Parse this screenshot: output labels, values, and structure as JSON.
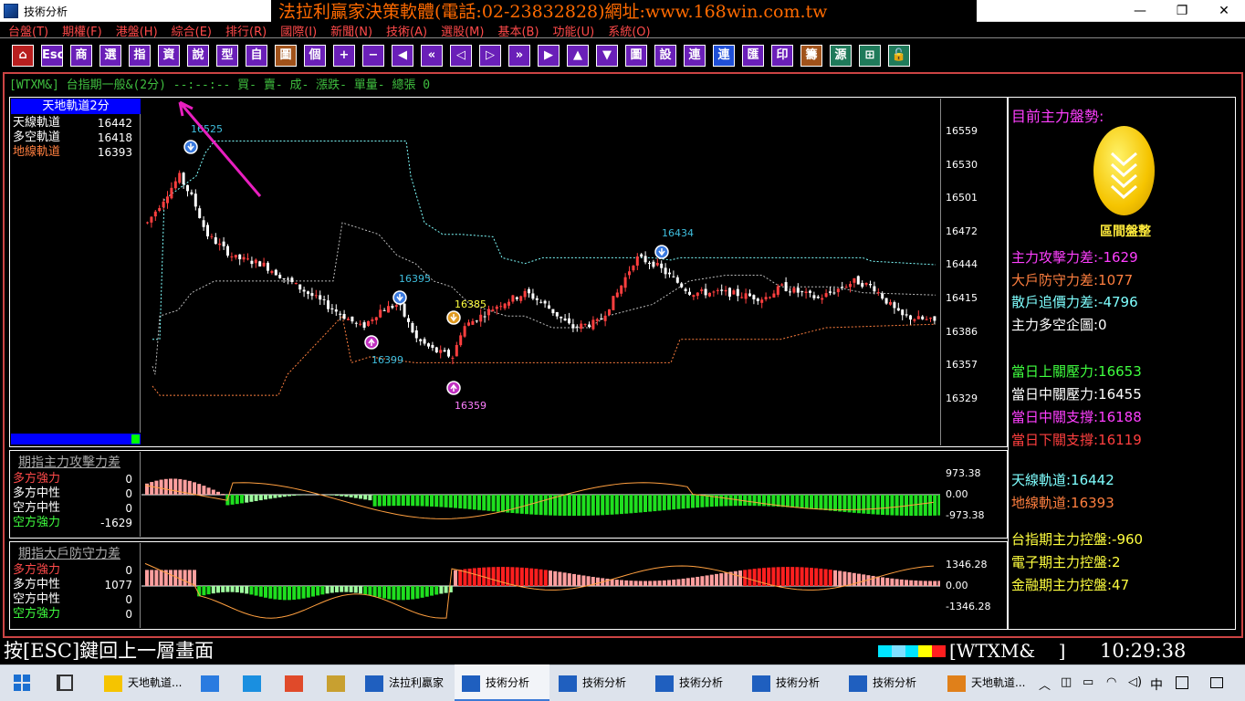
{
  "window": {
    "title": "技術分析",
    "banner": "法拉利贏家決策軟體(電話:02-23832828)網址:www.168win.com.tw",
    "min": "—",
    "restore": "❐",
    "close": "✕"
  },
  "menu": [
    "台盤(T)",
    "期權(F)",
    "港盤(H)",
    "綜合(E)",
    "排行(R)",
    "國際(I)",
    "新聞(N)",
    "技術(A)",
    "選股(M)",
    "基本(B)",
    "功能(U)",
    "系統(O)"
  ],
  "toolbar": [
    {
      "g": "⌂",
      "c": "red"
    },
    {
      "g": "Esc",
      "c": "purple"
    },
    {
      "g": "商",
      "c": "purple"
    },
    {
      "g": "選",
      "c": "purple"
    },
    {
      "g": "指",
      "c": "purple"
    },
    {
      "g": "資",
      "c": "purple"
    },
    {
      "g": "說",
      "c": "purple"
    },
    {
      "g": "型",
      "c": "purple"
    },
    {
      "g": "自",
      "c": "purple"
    },
    {
      "g": "圖",
      "c": "brown"
    },
    {
      "g": "個",
      "c": "purple"
    },
    {
      "g": "+",
      "c": "purple"
    },
    {
      "g": "−",
      "c": "purple"
    },
    {
      "g": "◀",
      "c": "purple"
    },
    {
      "g": "«",
      "c": "purple"
    },
    {
      "g": "◁",
      "c": "purple"
    },
    {
      "g": "▷",
      "c": "purple"
    },
    {
      "g": "»",
      "c": "purple"
    },
    {
      "g": "▶",
      "c": "purple"
    },
    {
      "g": "▲",
      "c": "purple"
    },
    {
      "g": "▼",
      "c": "purple"
    },
    {
      "g": "圖",
      "c": "purple"
    },
    {
      "g": "設",
      "c": "purple"
    },
    {
      "g": "連",
      "c": "purple"
    },
    {
      "g": "連",
      "c": "blue"
    },
    {
      "g": "匯",
      "c": "purple"
    },
    {
      "g": "印",
      "c": "purple"
    },
    {
      "g": "籌",
      "c": "brown"
    },
    {
      "g": "源",
      "c": "green"
    },
    {
      "g": "⊞",
      "c": "green"
    },
    {
      "g": "🔓",
      "c": "green"
    }
  ],
  "infobar": "[WTXM&] 台指期一般&(2分)  --:--:-- 買- 賣- 成- 漲跌- 單量- 總張 0",
  "legend": {
    "title": "天地軌道2分",
    "items": [
      {
        "label": "天線軌道",
        "value": "16442",
        "color": "#ffffff"
      },
      {
        "label": "多空軌道",
        "value": "16418",
        "color": "#ffffff"
      },
      {
        "label": "地線軌道",
        "value": "16393",
        "color": "#ff7f3f"
      }
    ]
  },
  "price_ticks": [
    "16559",
    "16530",
    "16501",
    "16472",
    "16444",
    "16415",
    "16386",
    "16357",
    "16329"
  ],
  "signals": {
    "s1": "16525",
    "s2": "16395",
    "s3": "16385",
    "s4": "16399",
    "s5": "16359",
    "s6": "16434"
  },
  "sub1": {
    "title": "期指主力攻擊力差",
    "items": [
      {
        "label": "多方強力",
        "value": "0",
        "color": "#ff4a4a"
      },
      {
        "label": "多方中性",
        "value": "0",
        "color": "#ffffff"
      },
      {
        "label": "空方中性",
        "value": "0",
        "color": "#ffffff"
      },
      {
        "label": "空方強力",
        "value": "-1629",
        "color": "#3fff3f"
      }
    ],
    "ticks": [
      "973.38",
      "0.00",
      "-973.38"
    ]
  },
  "sub2": {
    "title": "期指大戶防守力差",
    "items": [
      {
        "label": "多方強力",
        "value": "0",
        "color": "#ff4a4a"
      },
      {
        "label": "多方中性",
        "value": "1077",
        "color": "#ffffff"
      },
      {
        "label": "空方中性",
        "value": "0",
        "color": "#ffffff"
      },
      {
        "label": "空方強力",
        "value": "0",
        "color": "#3fff3f"
      }
    ],
    "ticks": [
      "1346.28",
      "0.00",
      "-1346.28"
    ]
  },
  "right": {
    "title": "目前主力盤勢:",
    "coin_label": "區間盤整",
    "rows": [
      {
        "text": "主力攻擊力差:-1629",
        "color": "#ff3fff"
      },
      {
        "text": "大戶防守力差:1077",
        "color": "#ff7f3f"
      },
      {
        "text": "散戶追價力差:-4796",
        "color": "#7fffff"
      },
      {
        "text": "主力多空企圖:0",
        "color": "#ffffff"
      },
      {
        "text": "當日上關壓力:16653",
        "color": "#3fff3f"
      },
      {
        "text": "當日中關壓力:16455",
        "color": "#ffffff"
      },
      {
        "text": "當日中關支撐:16188",
        "color": "#ff3fff"
      },
      {
        "text": "當日下關支撐:16119",
        "color": "#ff3f3f"
      },
      {
        "text": "天線軌道:16442",
        "color": "#7fffff"
      },
      {
        "text": "地線軌道:16393",
        "color": "#ff7f3f"
      },
      {
        "text": "台指期主力控盤:-960",
        "color": "#ffff3f"
      },
      {
        "text": "電子期主力控盤:2",
        "color": "#ffff3f"
      },
      {
        "text": "金融期主力控盤:47",
        "color": "#ffff3f"
      }
    ]
  },
  "status": {
    "message": "按[ESC]鍵回上一層畫面",
    "symbol": "[WTXM&    ]",
    "time": "10:29:38"
  },
  "taskbar": {
    "items": [
      {
        "label": "天地軌道...",
        "active": false
      },
      {
        "label": "",
        "active": false
      },
      {
        "label": "",
        "active": false
      },
      {
        "label": "",
        "active": false
      },
      {
        "label": "",
        "active": false
      },
      {
        "label": "法拉利贏家",
        "active": false
      },
      {
        "label": "技術分析",
        "active": true
      },
      {
        "label": "技術分析",
        "active": false
      },
      {
        "label": "技術分析",
        "active": false
      },
      {
        "label": "技術分析",
        "active": false
      },
      {
        "label": "技術分析",
        "active": false
      },
      {
        "label": "天地軌道...",
        "active": false
      }
    ],
    "ime": "中"
  },
  "colors": {
    "up": "#ff3f3f",
    "down": "#ffffff",
    "cyan": "#7fffff",
    "orange": "#ff7f3f",
    "green": "#3fdf3f",
    "pink": "#ff9f9f"
  }
}
